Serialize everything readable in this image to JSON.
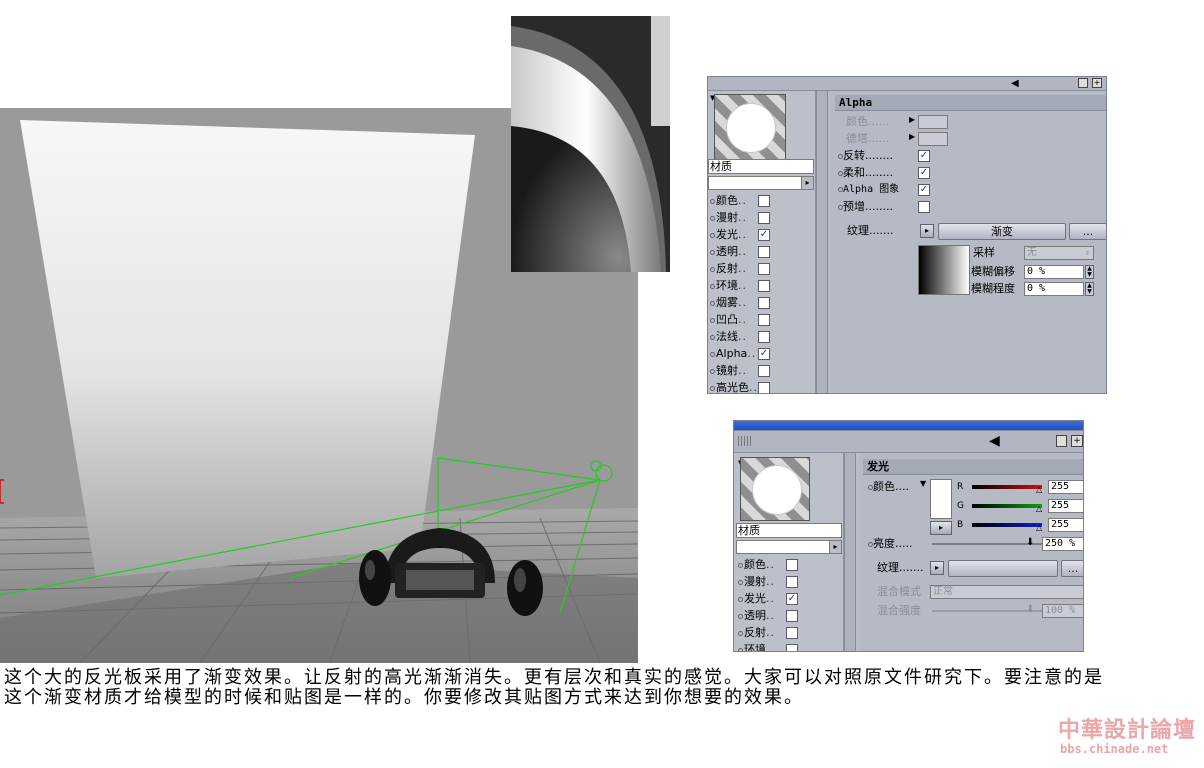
{
  "alpha_panel": {
    "material_name": "材质",
    "channels": [
      {
        "label": "颜色",
        "checked": false
      },
      {
        "label": "漫射",
        "checked": false
      },
      {
        "label": "发光",
        "checked": true
      },
      {
        "label": "透明",
        "checked": false
      },
      {
        "label": "反射",
        "checked": false
      },
      {
        "label": "环境",
        "checked": false
      },
      {
        "label": "烟雾",
        "checked": false
      },
      {
        "label": "凹凸",
        "checked": false
      },
      {
        "label": "法线",
        "checked": false
      },
      {
        "label": "Alpha",
        "checked": true
      },
      {
        "label": "镜射",
        "checked": false
      },
      {
        "label": "高光色",
        "checked": false
      }
    ],
    "section_title": "Alpha",
    "props": {
      "color": "颜色",
      "delta": "德塔",
      "invert": "反转",
      "soft": "柔和",
      "alpha_image": "Alpha 图象",
      "premultiplied": "预增",
      "texture": "纹理"
    },
    "checks": {
      "invert": true,
      "soft": true,
      "alpha_image": true,
      "premultiplied": false
    },
    "texture_button": "渐变",
    "more_button": "...",
    "sampling_label": "采样",
    "sampling_value": "无",
    "blur_offset_label": "模糊偏移",
    "blur_offset_value": "0 %",
    "blur_scale_label": "模糊程度",
    "blur_scale_value": "0 %"
  },
  "lum_panel": {
    "material_name": "材质",
    "channels": [
      {
        "label": "颜色",
        "checked": false
      },
      {
        "label": "漫射",
        "checked": false
      },
      {
        "label": "发光",
        "checked": true
      },
      {
        "label": "透明",
        "checked": false
      },
      {
        "label": "反射",
        "checked": false
      },
      {
        "label": "环境",
        "checked": false
      }
    ],
    "section_title": "发光",
    "color_label": "颜色",
    "r_label": "R",
    "r_value": "255",
    "g_label": "G",
    "g_value": "255",
    "b_label": "B",
    "b_value": "255",
    "brightness_label": "亮度",
    "brightness_value": "250 %",
    "texture_label": "纹理",
    "more_button": "...",
    "mix_mode_label": "混合模式",
    "mix_mode_value": "正常",
    "mix_strength_label": "混合强度",
    "mix_strength_value": "100 %"
  },
  "caption": "这个大的反光板采用了渐变效果。让反射的高光渐渐消失。更有层次和真实的感觉。大家可以对照原文件研究下。要注意的是这个渐变材质才给模型的时候和贴图是一样的。你要修改其贴图方式来达到你想要的效果。",
  "watermark": {
    "line1": "中華設計論壇",
    "line2": "bbs.chinade.net"
  },
  "colors": {
    "red_slider": "#d01010",
    "green_slider": "#10a010",
    "blue_slider": "#1020c0",
    "camera_line": "#22cc22"
  }
}
